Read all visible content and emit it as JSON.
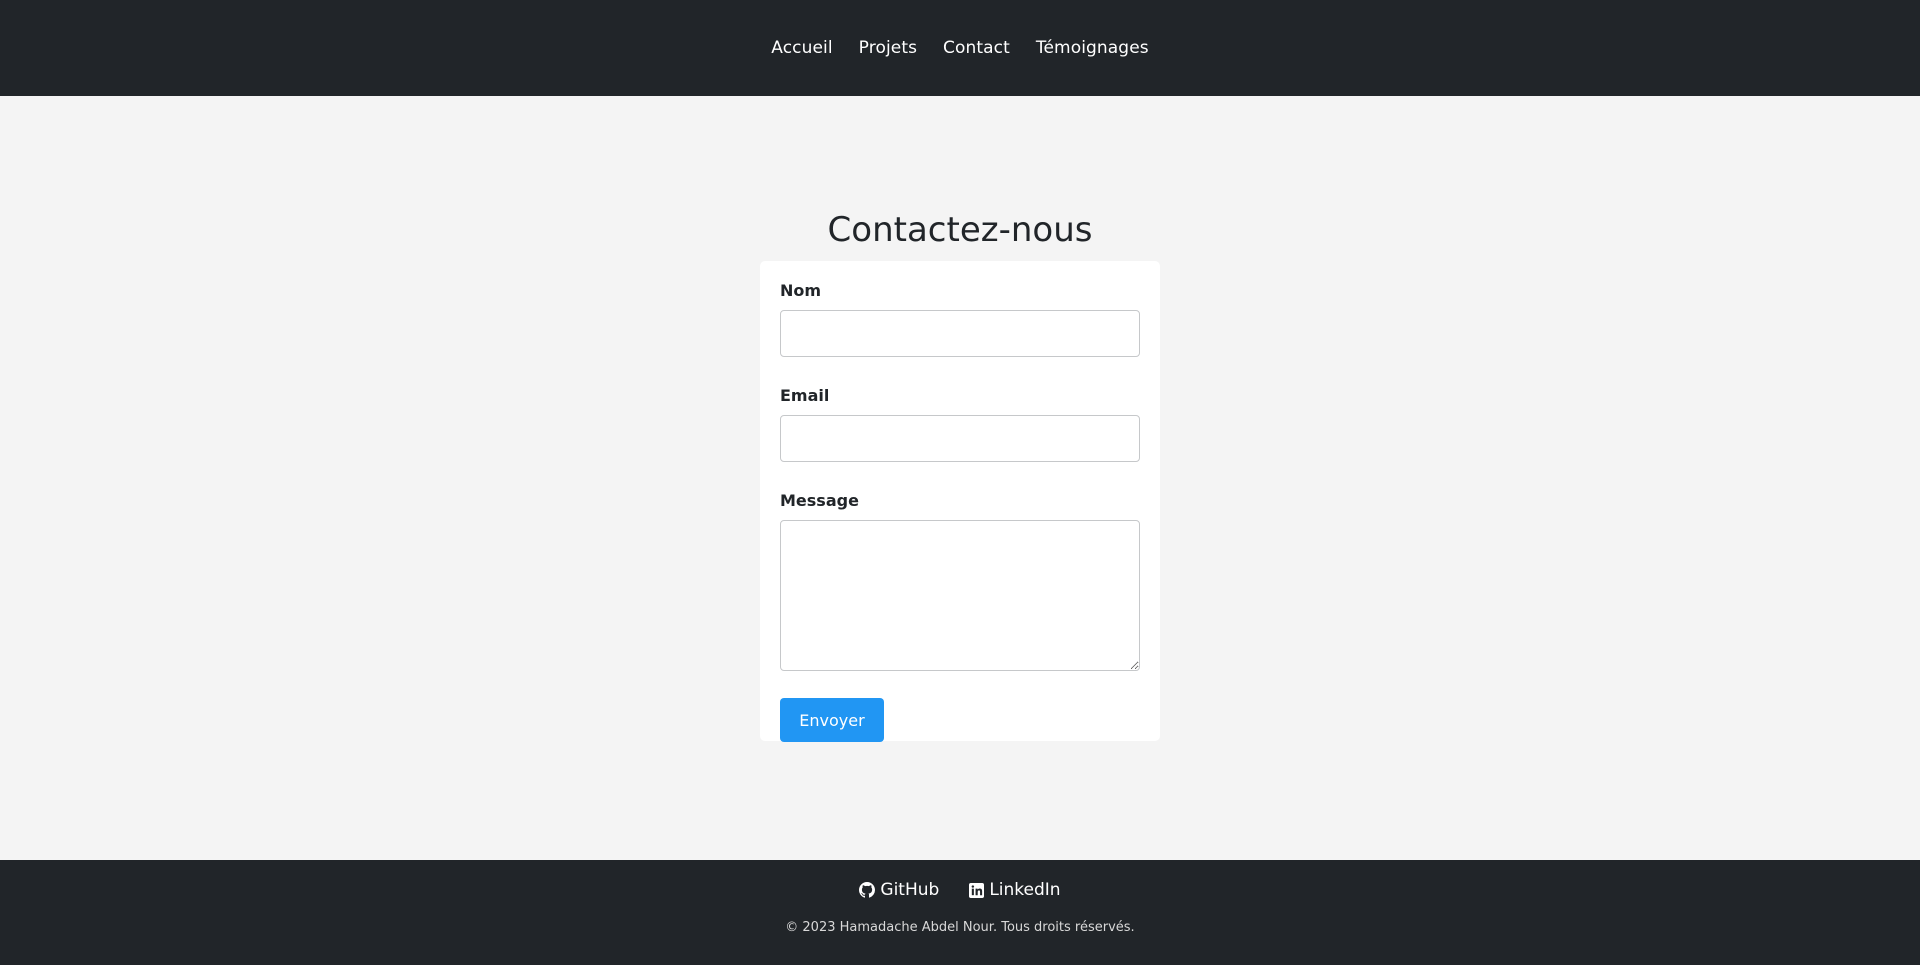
{
  "nav": {
    "items": [
      {
        "label": "Accueil"
      },
      {
        "label": "Projets"
      },
      {
        "label": "Contact"
      },
      {
        "label": "Témoignages"
      }
    ]
  },
  "contact": {
    "title": "Contactez-nous",
    "name_label": "Nom",
    "name_value": "",
    "email_label": "Email",
    "email_value": "",
    "message_label": "Message",
    "message_value": "",
    "submit_label": "Envoyer"
  },
  "footer": {
    "github_label": "GitHub",
    "github_icon": "github-icon",
    "linkedin_label": "LinkedIn",
    "linkedin_icon": "linkedin-icon",
    "copyright": "© 2023 Hamadache Abdel Nour. Tous droits réservés."
  },
  "colors": {
    "header_bg": "#212529",
    "page_bg": "#f4f4f4",
    "accent": "#2196f3"
  }
}
